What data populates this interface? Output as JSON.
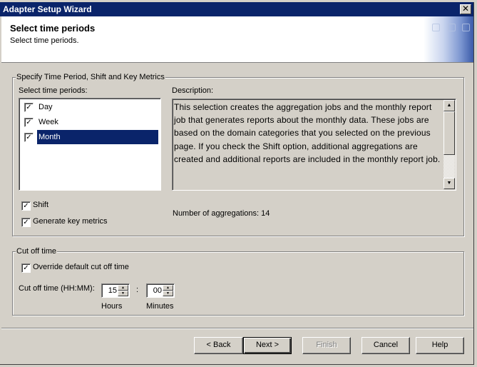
{
  "window": {
    "title": "Adapter Setup Wizard",
    "close_icon": "close-icon"
  },
  "header": {
    "title": "Select time periods",
    "subtitle": "Select time periods."
  },
  "metrics_group": {
    "legend": "Specify Time Period, Shift and Key Metrics",
    "periods_label": "Select time periods:",
    "periods": [
      {
        "label": "Day",
        "checked": true,
        "selected": false
      },
      {
        "label": "Week",
        "checked": true,
        "selected": false
      },
      {
        "label": "Month",
        "checked": true,
        "selected": true
      }
    ],
    "description_label": "Description:",
    "description": "This selection creates the aggregation jobs and the monthly report job that generates reports about the monthly data. These jobs are based on the domain categories that you selected on the previous page. If you check the Shift option, additional aggregations are created and additional reports are included in the monthly report job.",
    "shift": {
      "label": "Shift",
      "checked": true
    },
    "key_metrics": {
      "label": "Generate key metrics",
      "checked": true
    },
    "aggregations_label": "Number of aggregations:",
    "aggregations_count": "14"
  },
  "cutoff_group": {
    "legend": "Cut off time",
    "override": {
      "label": "Override default cut off time",
      "checked": true
    },
    "time_label": "Cut off time (HH:MM):",
    "hours_value": "15",
    "separator": ":",
    "minutes_value": "00",
    "hours_caption": "Hours",
    "minutes_caption": "Minutes"
  },
  "buttons": {
    "back": "< Back",
    "next": "Next >",
    "finish": "Finish",
    "cancel": "Cancel",
    "help": "Help"
  },
  "colors": {
    "titlebar": "#0a246a",
    "selection": "#0a246a",
    "face": "#d4d0c8"
  }
}
